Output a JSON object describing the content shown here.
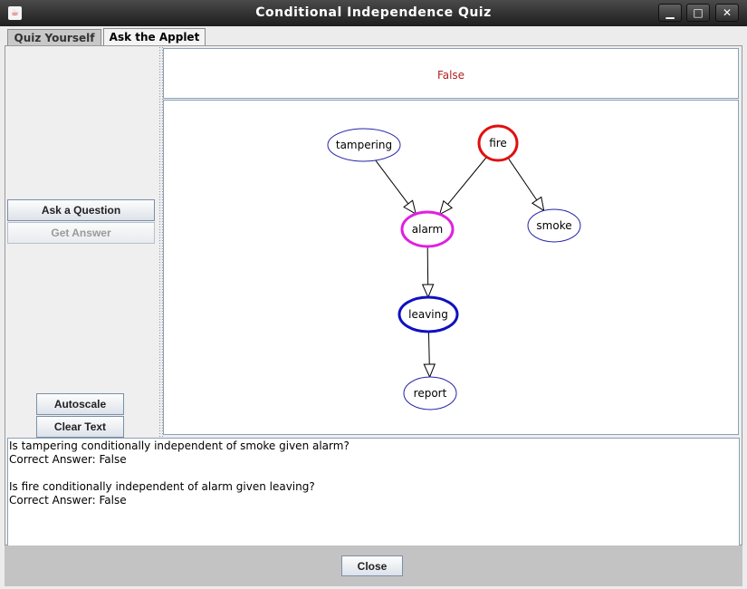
{
  "window": {
    "title": "Conditional Independence Quiz",
    "icon": "java-cup-icon",
    "controls": {
      "minimize": "▁",
      "maximize": "□",
      "close": "✕"
    }
  },
  "tabs": [
    {
      "label": "Quiz Yourself",
      "active": false
    },
    {
      "label": "Ask the Applet",
      "active": true
    }
  ],
  "left_panel": {
    "ask_label": "Ask a Question",
    "get_answer_label": "Get Answer",
    "autoscale_label": "Autoscale",
    "clear_label": "Clear Text"
  },
  "answer": {
    "text": "False",
    "color": "#b22222"
  },
  "graph": {
    "nodes": [
      {
        "id": "tampering",
        "label": "tampering",
        "border": "#2222aa",
        "highlight": "none"
      },
      {
        "id": "fire",
        "label": "fire",
        "border": "#e01010",
        "highlight": "red"
      },
      {
        "id": "alarm",
        "label": "alarm",
        "border": "#e020e0",
        "highlight": "magenta"
      },
      {
        "id": "smoke",
        "label": "smoke",
        "border": "#2222aa",
        "highlight": "none"
      },
      {
        "id": "leaving",
        "label": "leaving",
        "border": "#1010c0",
        "highlight": "blue"
      },
      {
        "id": "report",
        "label": "report",
        "border": "#2222aa",
        "highlight": "none"
      }
    ],
    "edges": [
      {
        "from": "tampering",
        "to": "alarm"
      },
      {
        "from": "fire",
        "to": "alarm"
      },
      {
        "from": "fire",
        "to": "smoke"
      },
      {
        "from": "alarm",
        "to": "leaving"
      },
      {
        "from": "leaving",
        "to": "report"
      }
    ]
  },
  "log": {
    "lines": [
      "Is tampering conditionally independent of smoke given alarm?",
      "Correct Answer: False",
      "",
      "Is fire conditionally independent of alarm given leaving?",
      "Correct Answer: False"
    ]
  },
  "footer": {
    "close_label": "Close"
  }
}
